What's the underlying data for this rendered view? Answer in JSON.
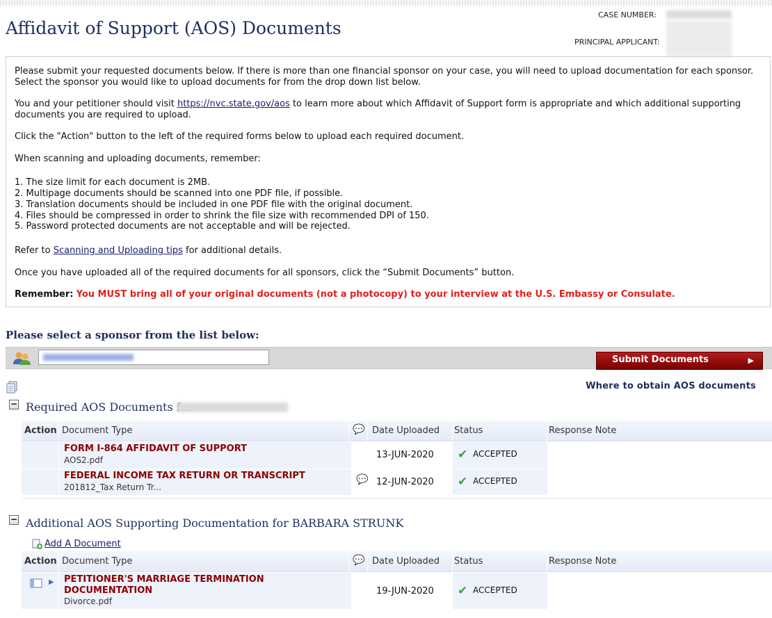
{
  "page": {
    "title": "Affidavit of Support (AOS) Documents",
    "case_number_label": "CASE NUMBER:",
    "principal_applicant_label": "PRINCIPAL APPLICANT:"
  },
  "info": {
    "p1": "Please submit your requested documents below. If there is more than one financial sponsor on your case, you will need to upload documentation for each sponsor. Select the sponsor you would like to upload documents for from the drop down list below.",
    "p2_before": "You and your petitioner should visit ",
    "p2_link": "https://nvc.state.gov/aos",
    "p2_after": " to learn more about which Affidavit of Support form is appropriate and which additional supporting documents you are required to upload.",
    "p3": "Click the \"Action\" button to the left of the required forms below to upload each required document.",
    "p4": "When scanning and uploading documents, remember:",
    "list": [
      "1. The size limit for each document is 2MB.",
      "2. Multipage documents should be scanned into one PDF file, if possible.",
      "3. Translation documents should be included in one PDF file with the original document.",
      "4. Files should be compressed in order to shrink the file size with recommended DPI of 150.",
      "5. Password protected documents are not acceptable and will be rejected."
    ],
    "p5_before": "Refer to ",
    "p5_link": "Scanning and Uploading tips",
    "p5_after": " for additional details.",
    "p6": "Once you have uploaded all of the required documents for all sponsors, click the “Submit Documents” button.",
    "remember_label": "Remember:",
    "remember_text": "You MUST bring all of your original documents (not a photocopy) to your interview at the U.S. Embassy or Consulate."
  },
  "sponsor": {
    "heading": "Please select a sponsor from the list below:",
    "submit_label": "Submit Documents",
    "where_link": "Where to obtain AOS documents"
  },
  "required": {
    "title": "Required AOS Documents for",
    "headers": [
      "Action",
      "Document Type",
      "Date Uploaded",
      "Status",
      "Response Note"
    ],
    "rows": [
      {
        "doc_type": "FORM I-864 AFFIDAVIT OF SUPPORT",
        "file": "AOS2.pdf",
        "date": "13-JUN-2020",
        "status": "ACCEPTED"
      },
      {
        "doc_type": "FEDERAL INCOME TAX RETURN OR TRANSCRIPT",
        "file": "201812_Tax Return Tr...",
        "date": "12-JUN-2020",
        "status": "ACCEPTED"
      }
    ]
  },
  "additional": {
    "title": "Additional AOS Supporting Documentation for BARBARA STRUNK",
    "add_link": "Add A Document",
    "headers": [
      "Action",
      "Document Type",
      "Date Uploaded",
      "Status",
      "Response Note"
    ],
    "rows": [
      {
        "doc_type_line1": "PETITIONER'S MARRIAGE TERMINATION",
        "doc_type_line2": "DOCUMENTATION",
        "file": "Divorce.pdf",
        "date": "19-JUN-2020",
        "status": "ACCEPTED"
      }
    ]
  },
  "colors": {
    "accent": "#1f2d5c",
    "doc_type": "#8b0000",
    "alert": "#e0201d",
    "submit": "#a01010"
  }
}
